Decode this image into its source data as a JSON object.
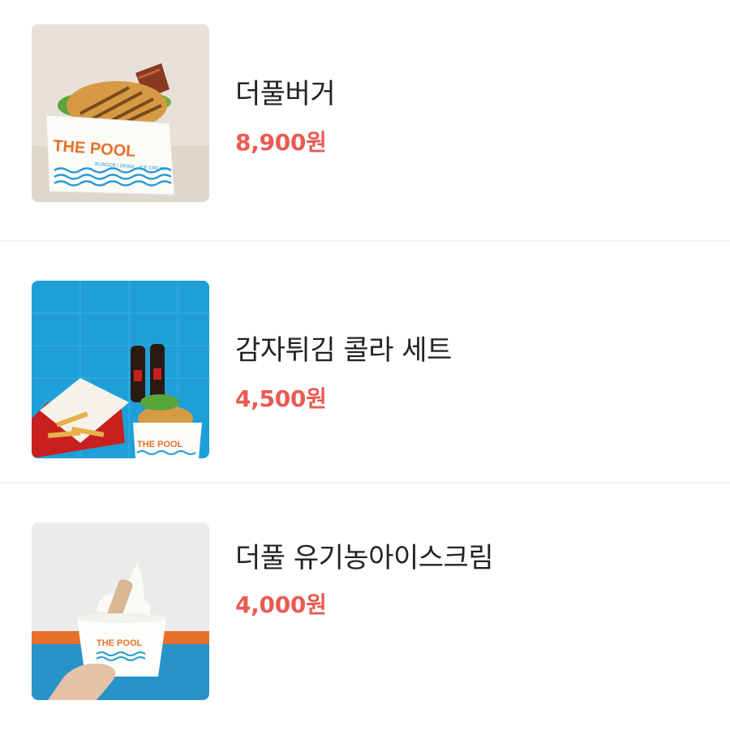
{
  "menu": {
    "items": [
      {
        "name": "더풀버거",
        "price": "8,900원",
        "image_text": "THE POOL",
        "image_subtext": "BURGER / DRINK · ICE CREAM"
      },
      {
        "name": "감자튀김 콜라 세트",
        "price": "4,500원",
        "image_text": "THE POOL"
      },
      {
        "name": "더풀 유기농아이스크림",
        "price": "4,000원",
        "image_text": "THE POOL"
      }
    ]
  },
  "colors": {
    "price": "#ea5a52",
    "divider": "#edf1f1",
    "brand_orange": "#e8702a",
    "brand_blue": "#2a9bd4"
  }
}
